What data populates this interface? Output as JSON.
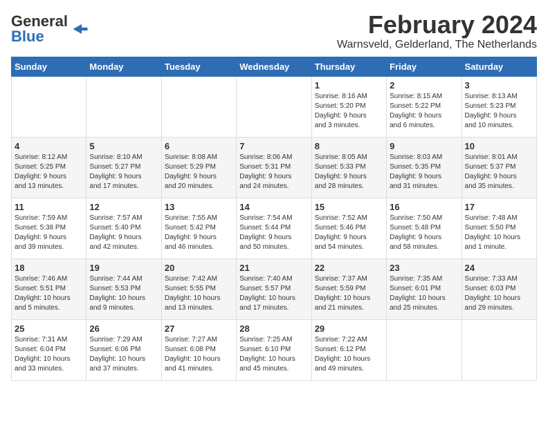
{
  "header": {
    "logo_general": "General",
    "logo_blue": "Blue",
    "month_year": "February 2024",
    "location": "Warnsveld, Gelderland, The Netherlands"
  },
  "days_of_week": [
    "Sunday",
    "Monday",
    "Tuesday",
    "Wednesday",
    "Thursday",
    "Friday",
    "Saturday"
  ],
  "weeks": [
    [
      {
        "day": "",
        "info": ""
      },
      {
        "day": "",
        "info": ""
      },
      {
        "day": "",
        "info": ""
      },
      {
        "day": "",
        "info": ""
      },
      {
        "day": "1",
        "info": "Sunrise: 8:16 AM\nSunset: 5:20 PM\nDaylight: 9 hours\nand 3 minutes."
      },
      {
        "day": "2",
        "info": "Sunrise: 8:15 AM\nSunset: 5:22 PM\nDaylight: 9 hours\nand 6 minutes."
      },
      {
        "day": "3",
        "info": "Sunrise: 8:13 AM\nSunset: 5:23 PM\nDaylight: 9 hours\nand 10 minutes."
      }
    ],
    [
      {
        "day": "4",
        "info": "Sunrise: 8:12 AM\nSunset: 5:25 PM\nDaylight: 9 hours\nand 13 minutes."
      },
      {
        "day": "5",
        "info": "Sunrise: 8:10 AM\nSunset: 5:27 PM\nDaylight: 9 hours\nand 17 minutes."
      },
      {
        "day": "6",
        "info": "Sunrise: 8:08 AM\nSunset: 5:29 PM\nDaylight: 9 hours\nand 20 minutes."
      },
      {
        "day": "7",
        "info": "Sunrise: 8:06 AM\nSunset: 5:31 PM\nDaylight: 9 hours\nand 24 minutes."
      },
      {
        "day": "8",
        "info": "Sunrise: 8:05 AM\nSunset: 5:33 PM\nDaylight: 9 hours\nand 28 minutes."
      },
      {
        "day": "9",
        "info": "Sunrise: 8:03 AM\nSunset: 5:35 PM\nDaylight: 9 hours\nand 31 minutes."
      },
      {
        "day": "10",
        "info": "Sunrise: 8:01 AM\nSunset: 5:37 PM\nDaylight: 9 hours\nand 35 minutes."
      }
    ],
    [
      {
        "day": "11",
        "info": "Sunrise: 7:59 AM\nSunset: 5:38 PM\nDaylight: 9 hours\nand 39 minutes."
      },
      {
        "day": "12",
        "info": "Sunrise: 7:57 AM\nSunset: 5:40 PM\nDaylight: 9 hours\nand 42 minutes."
      },
      {
        "day": "13",
        "info": "Sunrise: 7:55 AM\nSunset: 5:42 PM\nDaylight: 9 hours\nand 46 minutes."
      },
      {
        "day": "14",
        "info": "Sunrise: 7:54 AM\nSunset: 5:44 PM\nDaylight: 9 hours\nand 50 minutes."
      },
      {
        "day": "15",
        "info": "Sunrise: 7:52 AM\nSunset: 5:46 PM\nDaylight: 9 hours\nand 54 minutes."
      },
      {
        "day": "16",
        "info": "Sunrise: 7:50 AM\nSunset: 5:48 PM\nDaylight: 9 hours\nand 58 minutes."
      },
      {
        "day": "17",
        "info": "Sunrise: 7:48 AM\nSunset: 5:50 PM\nDaylight: 10 hours\nand 1 minute."
      }
    ],
    [
      {
        "day": "18",
        "info": "Sunrise: 7:46 AM\nSunset: 5:51 PM\nDaylight: 10 hours\nand 5 minutes."
      },
      {
        "day": "19",
        "info": "Sunrise: 7:44 AM\nSunset: 5:53 PM\nDaylight: 10 hours\nand 9 minutes."
      },
      {
        "day": "20",
        "info": "Sunrise: 7:42 AM\nSunset: 5:55 PM\nDaylight: 10 hours\nand 13 minutes."
      },
      {
        "day": "21",
        "info": "Sunrise: 7:40 AM\nSunset: 5:57 PM\nDaylight: 10 hours\nand 17 minutes."
      },
      {
        "day": "22",
        "info": "Sunrise: 7:37 AM\nSunset: 5:59 PM\nDaylight: 10 hours\nand 21 minutes."
      },
      {
        "day": "23",
        "info": "Sunrise: 7:35 AM\nSunset: 6:01 PM\nDaylight: 10 hours\nand 25 minutes."
      },
      {
        "day": "24",
        "info": "Sunrise: 7:33 AM\nSunset: 6:03 PM\nDaylight: 10 hours\nand 29 minutes."
      }
    ],
    [
      {
        "day": "25",
        "info": "Sunrise: 7:31 AM\nSunset: 6:04 PM\nDaylight: 10 hours\nand 33 minutes."
      },
      {
        "day": "26",
        "info": "Sunrise: 7:29 AM\nSunset: 6:06 PM\nDaylight: 10 hours\nand 37 minutes."
      },
      {
        "day": "27",
        "info": "Sunrise: 7:27 AM\nSunset: 6:08 PM\nDaylight: 10 hours\nand 41 minutes."
      },
      {
        "day": "28",
        "info": "Sunrise: 7:25 AM\nSunset: 6:10 PM\nDaylight: 10 hours\nand 45 minutes."
      },
      {
        "day": "29",
        "info": "Sunrise: 7:22 AM\nSunset: 6:12 PM\nDaylight: 10 hours\nand 49 minutes."
      },
      {
        "day": "",
        "info": ""
      },
      {
        "day": "",
        "info": ""
      }
    ]
  ]
}
